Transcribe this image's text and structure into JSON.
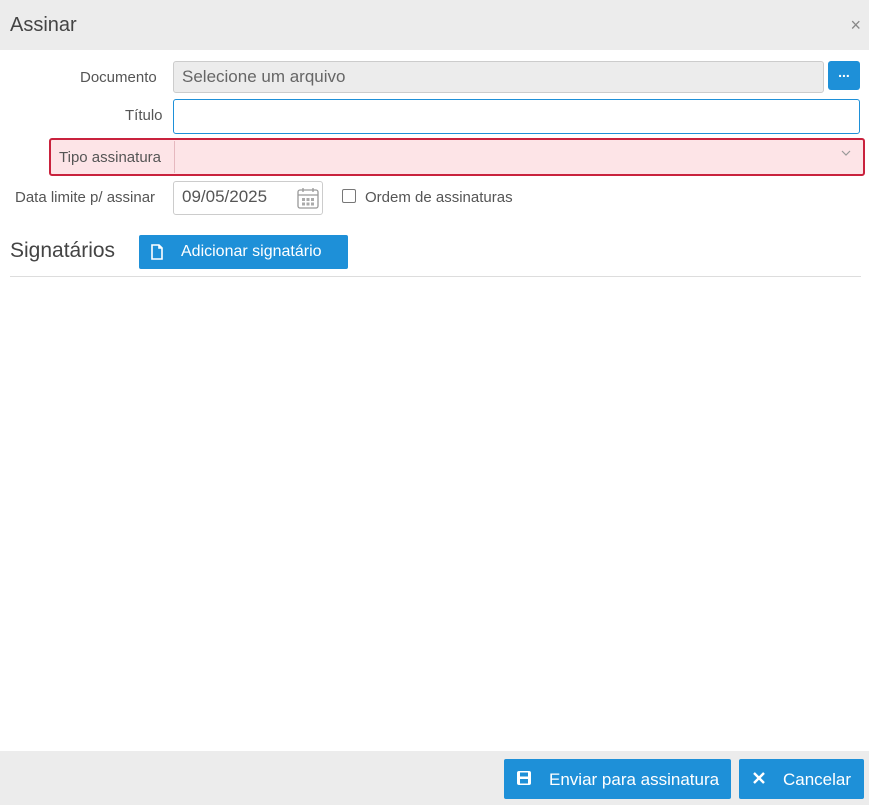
{
  "dialog": {
    "title": "Assinar",
    "close_symbol": "×"
  },
  "form": {
    "documento_label": "Documento",
    "documento_placeholder": "Selecione um arquivo",
    "browse_label": "...",
    "titulo_label": "Título",
    "titulo_value": "",
    "tipo_label": "Tipo assinatura",
    "tipo_value": "",
    "data_label": "Data limite p/ assinar",
    "data_value": "09/05/2025",
    "ordem_label": "Ordem de assinaturas",
    "ordem_checked": false
  },
  "signatarios": {
    "title": "Signatários",
    "add_label": "Adicionar signatário"
  },
  "footer": {
    "send_label": "Enviar para assinatura",
    "cancel_label": "Cancelar"
  },
  "colors": {
    "primary": "#1e90d8",
    "error_border": "#c9223d",
    "error_bg": "#fde4e7",
    "header_bg": "#ececec"
  },
  "icons": {
    "calendar": "calendar-icon",
    "document": "file-icon",
    "save": "save-icon",
    "close": "close-icon",
    "chevron": "chevron-down-icon"
  }
}
